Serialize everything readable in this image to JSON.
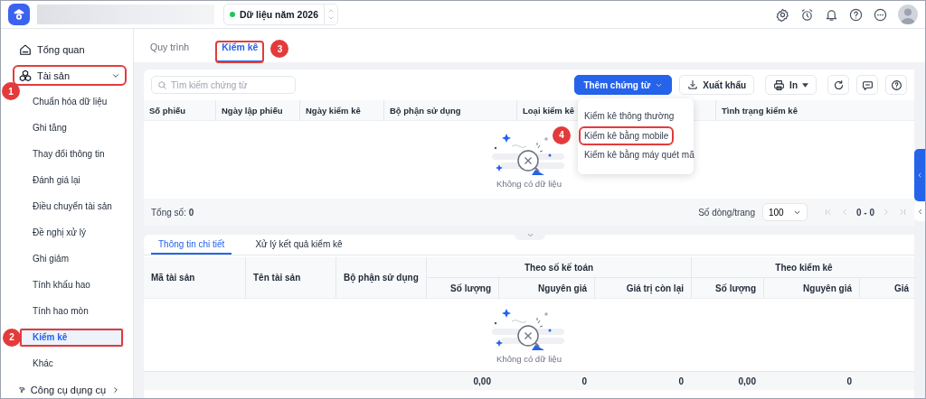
{
  "header": {
    "year_selector": {
      "label": "Dữ liệu năm 2026"
    }
  },
  "sidebar": {
    "items": [
      {
        "label": "Tổng quan",
        "kind": "link",
        "highlighted": false
      },
      {
        "label": "Tài sản",
        "kind": "group",
        "expanded": true,
        "highlighted": true,
        "marker": "1",
        "children": [
          {
            "label": "Chuẩn hóa dữ liệu",
            "selected": false,
            "highlighted": false
          },
          {
            "label": "Ghi tăng",
            "selected": false,
            "highlighted": false
          },
          {
            "label": "Thay đổi thông tin",
            "selected": false,
            "highlighted": false
          },
          {
            "label": "Đánh giá lại",
            "selected": false,
            "highlighted": false
          },
          {
            "label": "Điều chuyển tài sản",
            "selected": false,
            "highlighted": false
          },
          {
            "label": "Đề nghị xử lý",
            "selected": false,
            "highlighted": false
          },
          {
            "label": "Ghi giảm",
            "selected": false,
            "highlighted": false
          },
          {
            "label": "Tính khấu hao",
            "selected": false,
            "highlighted": false
          },
          {
            "label": "Tính hao mòn",
            "selected": false,
            "highlighted": false
          },
          {
            "label": "Kiểm kê",
            "selected": true,
            "highlighted": true,
            "marker": "2"
          },
          {
            "label": "Khác",
            "selected": false,
            "highlighted": false
          }
        ]
      },
      {
        "label": "Công cụ dụng cụ",
        "kind": "group",
        "expanded": false,
        "highlighted": false
      }
    ]
  },
  "tabs": [
    {
      "label": "Quy trình",
      "selected": false,
      "highlighted": false
    },
    {
      "label": "Kiểm kê",
      "selected": true,
      "highlighted": true,
      "marker": "3"
    }
  ],
  "toolbar": {
    "search": {
      "placeholder": "Tìm kiếm chứng từ"
    },
    "buttons": [
      {
        "kind": "primary",
        "label": "Thêm chứng từ"
      },
      {
        "kind": "export",
        "label": "Xuất khẩu"
      },
      {
        "kind": "print",
        "label": "In"
      },
      {
        "kind": "refresh"
      },
      {
        "kind": "comment"
      },
      {
        "kind": "help"
      }
    ]
  },
  "dropdown": {
    "items": [
      {
        "label": "Kiểm kê thông thường",
        "highlighted": false
      },
      {
        "label": "Kiểm kê bằng mobile",
        "highlighted": true,
        "marker": "4"
      },
      {
        "label": "Kiểm kê bằng máy quét mã",
        "highlighted": false
      }
    ]
  },
  "table": {
    "columns": [
      "Số phiếu",
      "Ngày lập phiếu",
      "Ngày kiểm kê",
      "Bộ phận sử dụng",
      "Loại kiểm kê",
      "Tình trạng kiểm kê"
    ],
    "empty_text": "Không có dữ liệu",
    "total": "Tổng số: **0**",
    "pagination": {
      "rows_label": "Số dòng/trang",
      "page_size": "100",
      "range": "0 - 0"
    }
  },
  "detail": {
    "tabs": [
      {
        "label": "Thông tin chi tiết",
        "selected": true
      },
      {
        "label": "Xử lý kết quả kiểm kê",
        "selected": false
      }
    ],
    "columns": [
      "Mã tài sản",
      "Tên tài sản",
      "Bộ phận sử dụng"
    ],
    "groups": [
      {
        "label": "Theo số kế toán",
        "columns": [
          "Số lượng",
          "Nguyên giá",
          "Giá trị còn lại"
        ],
        "totals": [
          "0,00",
          "0",
          "0"
        ]
      },
      {
        "label": "Theo kiểm kê",
        "columns": [
          "Số lượng",
          "Nguyên giá",
          "Giá"
        ],
        "totals": [
          "0,00",
          "0"
        ]
      }
    ],
    "empty_text": "Không có dữ liệu"
  }
}
